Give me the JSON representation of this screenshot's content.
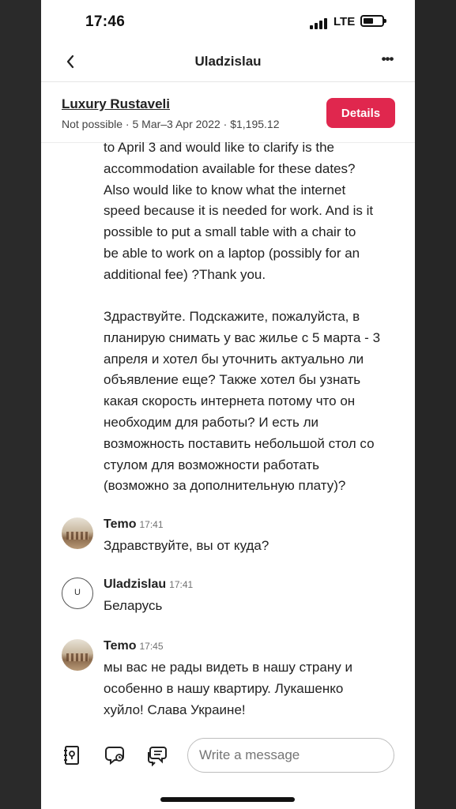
{
  "status_bar": {
    "time": "17:46",
    "network": "LTE"
  },
  "nav": {
    "title": "Uladzislau",
    "back_icon": "chevron-left-icon",
    "more_icon": "more-horizontal-icon",
    "more_glyph": "•••"
  },
  "listing": {
    "name": "Luxury Rustaveli",
    "meta": "Not possible · 5 Mar–3 Apr 2022 · $1,195.12",
    "details_label": "Details",
    "accent_color": "#e0274e"
  },
  "thread": {
    "first_message_en": "to April 3 and would like to clarify is the\naccommodation available for these dates?\nAlso would like to know what the internet\nspeed because it is needed for work. And is it\npossible to put a small table with a chair to\nbe able to work on a laptop (possibly for an\nadditional fee) ?Thank you.",
    "first_message_ru": "Здраствуйте. Подскажите, пожалуйста, в\nпланирую снимать у вас жилье с 5 марта - 3\nапреля и хотел бы уточнить актуально ли\nобъявление еще? Также хотел бы узнать\nкакая скорость интернета потому что он\nнеобходим для работы? И есть ли\nвозможность поставить небольшой стол со\nстулом для возможности работать\n(возможно за дополнительную плату)?",
    "messages": [
      {
        "author": "Temo",
        "time": "17:41",
        "text": "Здравствуйте, вы от куда?",
        "avatar": "photo"
      },
      {
        "author": "Uladzislau",
        "time": "17:41",
        "text": "Беларусь",
        "avatar": "U"
      },
      {
        "author": "Temo",
        "time": "17:45",
        "text": "мы вас не рады видеть в нашу страну и\nособенно в нашу квартиру. Лукашенко\nхуйло! Слава Украине!",
        "avatar": "photo"
      }
    ]
  },
  "composer": {
    "placeholder": "Write a message",
    "tools": [
      "itinerary-icon",
      "quick-reply-icon",
      "translate-icon"
    ]
  }
}
